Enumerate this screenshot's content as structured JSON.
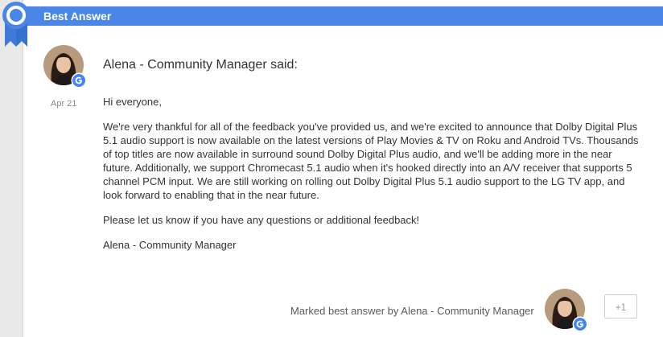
{
  "header": {
    "title": "Best Answer"
  },
  "post": {
    "author_line": "Alena - Community Manager said:",
    "date": "Apr 21",
    "paragraphs": [
      "Hi everyone,",
      "We're very thankful for all of the feedback you've provided us, and we're excited to announce that Dolby Digital Plus 5.1 audio support is now available on the latest versions of Play Movies & TV on Roku and Android TVs. Thousands of top titles are now available in surround sound Dolby Digital Plus audio, and we'll be adding more in the near future. Additionally, we support Chromecast 5.1 audio when it's hooked directly into an A/V receiver that supports 5 channel PCM input. We are still working on rolling out Dolby Digital Plus 5.1 audio support to the LG TV app, and look forward to enabling that in the near future.",
      "Please let us know if you have any questions or additional feedback!",
      "Alena - Community Manager"
    ]
  },
  "footer": {
    "marked_text": "Marked best answer by Alena - Community Manager",
    "plus_one_label": "+1"
  },
  "colors": {
    "header_blue": "#4a86e8",
    "badge_blue": "#4285f4"
  },
  "icons": {
    "ribbon": "award-ribbon-icon",
    "badge": "google-g-badge-icon"
  }
}
